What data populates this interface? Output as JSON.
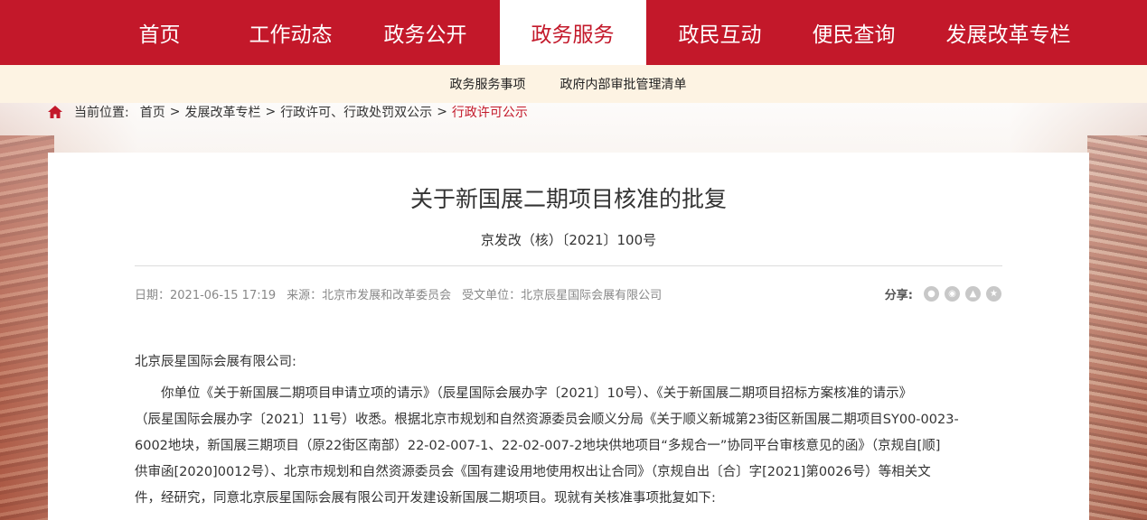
{
  "nav": {
    "items": [
      {
        "label": "首页"
      },
      {
        "label": "工作动态"
      },
      {
        "label": "政务公开"
      },
      {
        "label": "政务服务"
      },
      {
        "label": "政民互动"
      },
      {
        "label": "便民查询"
      },
      {
        "label": "发展改革专栏"
      }
    ],
    "active_index": 3,
    "color": "#c3182a"
  },
  "subnav": {
    "items": [
      {
        "label": "政务服务事项"
      },
      {
        "label": "政府内部审批管理清单"
      }
    ]
  },
  "breadcrumb": {
    "prefix": "当前位置:",
    "items": [
      "首页",
      "发展改革专栏",
      "行政许可、行政处罚双公示",
      "行政许可公示"
    ],
    "separator": ">"
  },
  "article": {
    "title": "关于新国展二期项目核准的批复",
    "doc_number": "京发改（核）〔2021〕100号",
    "date": "日期：2021-06-15 17:19",
    "source": "来源：北京市发展和改革委员会",
    "recipient": "受文单位：北京辰星国际会展有限公司",
    "share_label": "分享:",
    "share_icons": [
      "wechat-icon",
      "weibo-icon",
      "qq-icon",
      "qzone-icon"
    ],
    "greeting": "北京辰星国际会展有限公司:",
    "paragraph_lines": [
      "你单位《关于新国展二期项目申请立项的请示》（辰星国际会展办字〔2021〕10号）、《关于新国展二期项目招标方案核准的请示》",
      "（辰星国际会展办字〔2021〕11号）收悉。根据北京市规划和自然资源委员会顺义分局《关于顺义新城第23街区新国展二期项目SY00-0023-",
      "6002地块，新国展三期项目（原22街区南部）22-02-007-1、22-02-007-2地块供地项目“多规合一”协同平台审核意见的函》（京规自[顺]",
      "供审函[2020]0012号）、北京市规划和自然资源委员会《国有建设用地使用权出让合同》（京规自出〔合〕字[2021]第0026号）等相关文",
      "件，经研究，同意北京辰星国际会展有限公司开发建设新国展二期项目。现就有关核准事项批复如下:"
    ]
  }
}
